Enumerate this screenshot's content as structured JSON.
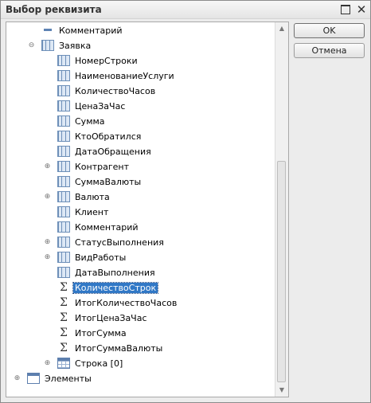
{
  "window": {
    "title": "Выбор реквизита"
  },
  "buttons": {
    "ok": "OK",
    "cancel": "Отмена"
  },
  "tree": {
    "items": [
      {
        "label": "Комментарий",
        "icon": "attribute-dash-icon"
      },
      {
        "label": "Заявка",
        "icon": "document-table-icon",
        "expander": "⊖"
      },
      {
        "label": "НомерСтроки",
        "icon": "attribute-icon"
      },
      {
        "label": "НаименованиеУслуги",
        "icon": "attribute-icon"
      },
      {
        "label": "КоличествоЧасов",
        "icon": "attribute-icon"
      },
      {
        "label": "ЦенаЗаЧас",
        "icon": "attribute-icon"
      },
      {
        "label": "Сумма",
        "icon": "attribute-icon"
      },
      {
        "label": "КтоОбратился",
        "icon": "attribute-icon"
      },
      {
        "label": "ДатаОбращения",
        "icon": "attribute-icon"
      },
      {
        "label": "Контрагент",
        "icon": "attribute-icon",
        "expander": "⊕"
      },
      {
        "label": "СуммаВалюты",
        "icon": "attribute-icon"
      },
      {
        "label": "Валюта",
        "icon": "attribute-icon",
        "expander": "⊕"
      },
      {
        "label": "Клиент",
        "icon": "attribute-icon"
      },
      {
        "label": "Комментарий",
        "icon": "attribute-icon"
      },
      {
        "label": "СтатусВыполнения",
        "icon": "attribute-icon",
        "expander": "⊕"
      },
      {
        "label": "ВидРаботы",
        "icon": "attribute-icon",
        "expander": "⊕"
      },
      {
        "label": "ДатаВыполнения",
        "icon": "attribute-icon"
      },
      {
        "label": "КоличествоСтрок",
        "icon": "sigma-icon",
        "selected": true
      },
      {
        "label": "ИтогКоличествоЧасов",
        "icon": "sigma-icon"
      },
      {
        "label": "ИтогЦенаЗаЧас",
        "icon": "sigma-icon"
      },
      {
        "label": "ИтогСумма",
        "icon": "sigma-icon"
      },
      {
        "label": "ИтогСуммаВалюты",
        "icon": "sigma-icon"
      },
      {
        "label": "Строка [0]",
        "icon": "grid-icon",
        "expander": "⊕"
      },
      {
        "label": "Элементы",
        "icon": "window-icon",
        "expander": "⊕"
      }
    ]
  },
  "colors": {
    "selection": "#3178c6",
    "icon_blue": "#6d8fb8"
  }
}
